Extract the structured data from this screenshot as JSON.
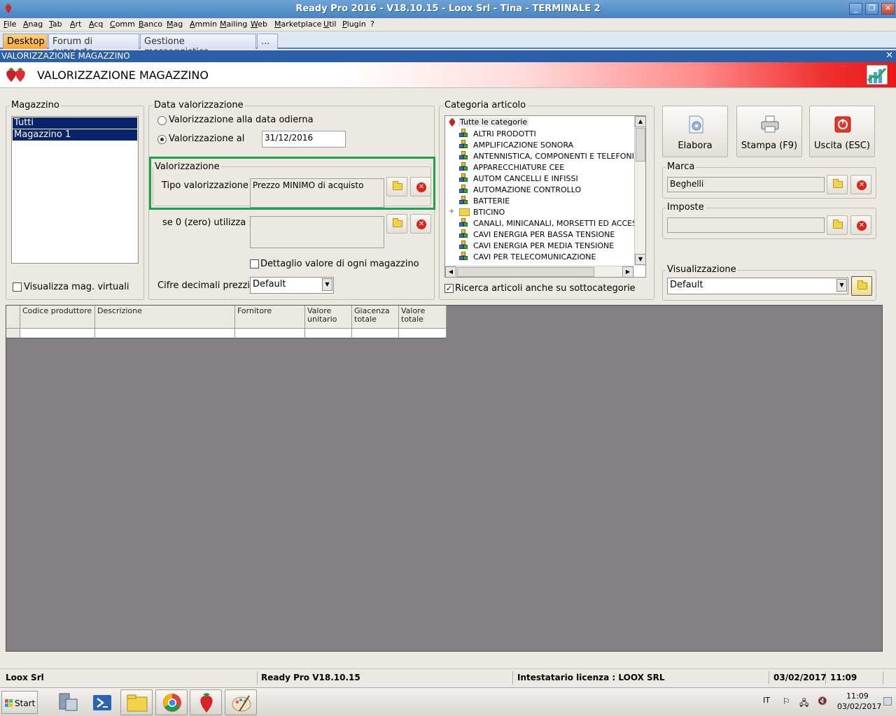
{
  "window": {
    "title": "Ready Pro 2016 - V18.10.15 - Loox Srl - Tina - TERMINALE 2",
    "minimize": "_",
    "restore": "❐",
    "close": "✕"
  },
  "menu": [
    {
      "label": "File",
      "u": "F",
      "rest": "ile"
    },
    {
      "label": "Anag",
      "u": "A",
      "rest": "nag"
    },
    {
      "label": "Tab",
      "u": "T",
      "rest": "ab"
    },
    {
      "label": "Art",
      "u": "A",
      "rest": "rt"
    },
    {
      "label": "Acq",
      "u": "A",
      "rest": "cq"
    },
    {
      "label": "Comm",
      "u": "C",
      "rest": "omm"
    },
    {
      "label": "Banco",
      "u": "B",
      "rest": "anco"
    },
    {
      "label": "Mag",
      "u": "M",
      "rest": "ag"
    },
    {
      "label": "Ammin",
      "u": "A",
      "rest": "mmin"
    },
    {
      "label": "Mailing",
      "u": "M",
      "rest": "ailing"
    },
    {
      "label": "Web",
      "u": "W",
      "rest": "eb"
    },
    {
      "label": "Marketplace",
      "u": "M",
      "rest": "arketplace"
    },
    {
      "label": "Util",
      "u": "U",
      "rest": "til"
    },
    {
      "label": "Plugin",
      "u": "P",
      "rest": "lugin"
    },
    {
      "label": "?",
      "u": "",
      "rest": "?"
    }
  ],
  "tabs": [
    "Desktop",
    "Forum di supporto",
    "Gestione messaggistica",
    "..."
  ],
  "form": {
    "caption": "VALORIZZAZIONE MAGAZZINO",
    "title": "VALORIZZAZIONE MAGAZZINO",
    "close": "✕"
  },
  "magazzino": {
    "label": "Magazzino",
    "items": [
      "Tutti",
      "Magazzino 1"
    ],
    "virtual_label": "Visualizza mag. virtuali",
    "virtual_checked": false
  },
  "data_val": {
    "label": "Data valorizzazione",
    "option_today": "Valorizzazione alla data odierna",
    "option_at": "Valorizzazione al",
    "date_value": "31/12/2016",
    "selected": "at"
  },
  "valorizzazione": {
    "label": "Valorizzazione",
    "tipo_label": "Tipo valorizzazione :",
    "tipo_value": "Prezzo MINIMO di acquisto",
    "zero_label": "se 0 (zero) utilizza :",
    "zero_value": "",
    "dettaglio_label": "Dettaglio valore di ogni magazzino",
    "dettaglio_checked": false,
    "cifre_label": "Cifre decimali prezzi :",
    "cifre_value": "Default",
    "highlight_color": "#1fa34a"
  },
  "categoria": {
    "label": "Categoria articolo",
    "root": "Tutte le categorie",
    "items": [
      "ALTRI PRODOTTI",
      "AMPLIFICAZIONE SONORA",
      "ANTENNISTICA, COMPONENTI E TELEFONIA",
      "APPARECCHIATURE CEE",
      "AUTOM CANCELLI E INFISSI",
      "AUTOMAZIONE CONTROLLO",
      "BATTERIE",
      "BTICINO",
      "CANALI, MINICANALI, MORSETTI ED ACCESSORI",
      "CAVI ENERGIA PER BASSA TENSIONE",
      "CAVI ENERGIA PER MEDIA TENSIONE",
      "CAVI PER TELECOMUNICAZIONE"
    ],
    "subcat_label": "Ricerca articoli anche su sottocategorie",
    "subcat_checked": true
  },
  "actions": {
    "elabora": "Elabora",
    "stampa": "Stampa (F9)",
    "uscita": "Uscita (ESC)"
  },
  "marca": {
    "label": "Marca",
    "value": "Beghelli"
  },
  "imposte": {
    "label": "Imposte",
    "value": ""
  },
  "visualizzazione": {
    "label": "Visualizzazione",
    "value": "Default"
  },
  "grid": {
    "columns": [
      "Codice produttore",
      "Descrizione",
      "Fornitore",
      "Valore unitario",
      "Giacenza totale",
      "Valore totale"
    ]
  },
  "status": {
    "company": "Loox Srl",
    "version": "Ready Pro V18.10.15",
    "license": "Intestatario licenza : LOOX SRL",
    "date": "03/02/2017",
    "time": "11:09"
  },
  "taskbar": {
    "start": "Start",
    "lang": "IT",
    "clock_time": "11:09",
    "clock_date": "03/02/2017"
  },
  "colors": {
    "selection": "#0a246a",
    "form_caption": "#2b5fa8",
    "grid_background": "#838185",
    "active_tab": "#f6a838"
  }
}
